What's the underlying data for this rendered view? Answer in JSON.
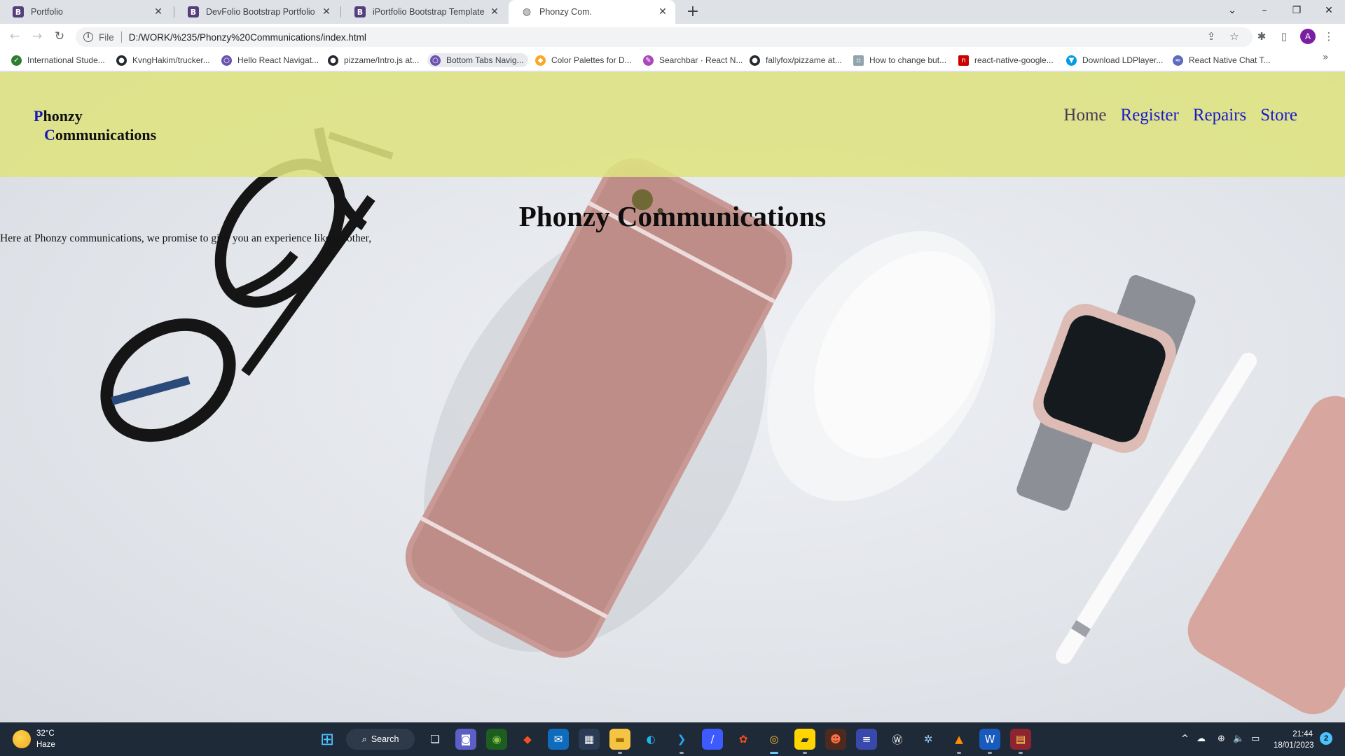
{
  "browser": {
    "tabs": [
      {
        "title": "Portfolio",
        "favicon_letter": "B",
        "active": false
      },
      {
        "title": "DevFolio Bootstrap Portfolio Tem",
        "favicon_letter": "B",
        "active": false
      },
      {
        "title": "iPortfolio Bootstrap Template - Ir",
        "favicon_letter": "B",
        "active": false
      },
      {
        "title": "Phonzy Com.",
        "favicon_letter": "",
        "active": true
      }
    ],
    "close_glyph": "✕",
    "new_tab_glyph": "+",
    "window_controls": {
      "dropdown": "⌄",
      "minimize": "–",
      "restore": "❐",
      "close": "✕"
    },
    "nav": {
      "back": "←",
      "forward": "→",
      "reload": "↻"
    },
    "address": {
      "info_icon": "i",
      "scheme": "File",
      "url": "D:/WORK/%235/Phonzy%20Communications/index.html"
    },
    "toolbar_icons": {
      "share": "⇪",
      "star": "☆",
      "extensions": "✱",
      "sidepanel": "▯",
      "menu": "⋮"
    },
    "profile_initial": "A",
    "bookmarks": [
      {
        "label": "International Stude...",
        "icon": "shield-icon",
        "color": "#2e7d32"
      },
      {
        "label": "KvngHakim/trucker...",
        "icon": "github-icon",
        "color": "#24292f"
      },
      {
        "label": "Hello React Navigat...",
        "icon": "react-navigation-icon",
        "color": "#6b52ae"
      },
      {
        "label": "pizzame/Intro.js at...",
        "icon": "github-icon",
        "color": "#24292f"
      },
      {
        "label": "Bottom Tabs Navig...",
        "icon": "react-navigation-icon",
        "color": "#6b52ae"
      },
      {
        "label": "Color Palettes for D...",
        "icon": "palette-icon",
        "color": "#f9a825"
      },
      {
        "label": "Searchbar · React N...",
        "icon": "feather-icon",
        "color": "#ab47bc"
      },
      {
        "label": "fallyfox/pizzame at...",
        "icon": "github-icon",
        "color": "#24292f"
      },
      {
        "label": "How to change but...",
        "icon": "page-icon",
        "color": "#90a4ae"
      },
      {
        "label": "react-native-google...",
        "icon": "npm-icon",
        "color": "#cb0000"
      },
      {
        "label": "Download LDPlayer...",
        "icon": "ldplayer-icon",
        "color": "#039be5"
      },
      {
        "label": "React Native Chat T...",
        "icon": "chat-icon",
        "color": "#5c6bc0"
      }
    ],
    "bookmarks_more": "»"
  },
  "site": {
    "logo": {
      "line1_initial": "P",
      "line1_rest": "honzy",
      "line2_initial": "C",
      "line2_rest": "ommunications"
    },
    "nav": [
      "Home",
      "Register",
      "Repairs",
      "Store"
    ],
    "hero_title": "Phonzy Communications",
    "intro_text": "Here at Phonzy communications, we promise to give you an experience like no other,"
  },
  "taskbar": {
    "weather": {
      "temp": "32°C",
      "condition": "Haze"
    },
    "search_label": "Search",
    "apps": [
      {
        "name": "start",
        "glyph": "⊞",
        "bg": "transparent",
        "fg": "#4cc2ff"
      },
      {
        "name": "task-view",
        "glyph": "❏",
        "bg": "transparent",
        "fg": "#ffffff"
      },
      {
        "name": "teams-chat",
        "glyph": "◙",
        "bg": "#5b5fc7",
        "fg": "#ffffff"
      },
      {
        "name": "edge-dev",
        "glyph": "◉",
        "bg": "#1b5e20",
        "fg": "#8bc34a"
      },
      {
        "name": "git",
        "glyph": "◆",
        "bg": "transparent",
        "fg": "#f4511e"
      },
      {
        "name": "mail",
        "glyph": "✉",
        "bg": "#0f6cbd",
        "fg": "#ffffff"
      },
      {
        "name": "store",
        "glyph": "▦",
        "bg": "#2b3a55",
        "fg": "#ffffff"
      },
      {
        "name": "file-explorer",
        "glyph": "▬",
        "bg": "#f6c443",
        "fg": "#a66f00"
      },
      {
        "name": "edge",
        "glyph": "◐",
        "bg": "transparent",
        "fg": "#1fb6e8"
      },
      {
        "name": "vscode",
        "glyph": "❯",
        "bg": "transparent",
        "fg": "#23a9f2"
      },
      {
        "name": "whiteboard",
        "glyph": "∕",
        "bg": "#3d5afe",
        "fg": "#ffffff"
      },
      {
        "name": "figma",
        "glyph": "✿",
        "bg": "transparent",
        "fg": "#f24e1e"
      },
      {
        "name": "chrome",
        "glyph": "◎",
        "bg": "transparent",
        "fg": "#fbc02d"
      },
      {
        "name": "sticky-notes",
        "glyph": "▰",
        "bg": "#ffd600",
        "fg": "#333333"
      },
      {
        "name": "game",
        "glyph": "☻",
        "bg": "#4e2a1e",
        "fg": "#ff7043"
      },
      {
        "name": "terminal",
        "glyph": "≡",
        "bg": "#3949ab",
        "fg": "#ffffff"
      },
      {
        "name": "app-w",
        "glyph": "Ⓦ",
        "bg": "transparent",
        "fg": "#ffffff"
      },
      {
        "name": "settings-gear",
        "glyph": "✲",
        "bg": "transparent",
        "fg": "#90caf9"
      },
      {
        "name": "vlc",
        "glyph": "▲",
        "bg": "transparent",
        "fg": "#ff8f00"
      },
      {
        "name": "word",
        "glyph": "W",
        "bg": "#185abd",
        "fg": "#ffffff"
      },
      {
        "name": "winrar",
        "glyph": "▤",
        "bg": "#8e2430",
        "fg": "#ffd54f"
      }
    ],
    "tray": {
      "chevron": "^",
      "onedrive": "☁",
      "network": "⊕",
      "volume": "🔈",
      "battery": "▭"
    },
    "time": "21:44",
    "date": "18/01/2023",
    "notifications": "2"
  },
  "colors": {
    "header_bg": "#dee380",
    "nav_link": "#1a1acb",
    "nav_visited": "#4a3a55",
    "logo_initial": "#1a1ab8",
    "taskbar_bg": "#1f2a38"
  }
}
